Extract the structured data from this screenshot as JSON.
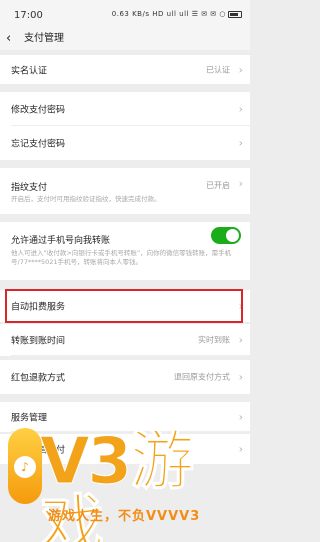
{
  "status_bar": {
    "time": "17:00",
    "icons_text": "0.63 KB/s HD ull ull ☰ ✉ ✉ ○"
  },
  "header": {
    "back_icon": "chevron-left",
    "title": "支付管理"
  },
  "rows": {
    "real_name": {
      "label": "实名认证",
      "value": "已认证"
    },
    "change_password": {
      "label": "修改支付密码"
    },
    "forgot_password": {
      "label": "忘记支付密码"
    },
    "fingerprint": {
      "label": "指纹支付",
      "value": "已开启",
      "desc": "开启后，支付时可用指纹验证指纹，快速完成付款。"
    },
    "allow_transfer": {
      "label": "允许通过手机号向我转账",
      "toggle_on": true,
      "desc": "他人可进入“收付款>向银行卡或手机号转账”，向你的微信零钱转账，需手机号/77****5021手机号，转账将向本人零钱。"
    },
    "auto_debit": {
      "label": "自动扣费服务"
    },
    "transfer_time": {
      "label": "转账到账时间",
      "value": "实时到账"
    },
    "refund_method": {
      "label": "红包退款方式",
      "value": "退回原支付方式"
    },
    "service_mgmt": {
      "label": "服务管理"
    },
    "logout": {
      "label": "注销微信支付"
    }
  },
  "watermark": {
    "brand": "V3游戏",
    "slogan": "游戏人生，不负VVVV3"
  },
  "colors": {
    "toggle_on": "#1aad19",
    "highlight": "#d7262c",
    "brand": "#f2a31a"
  }
}
